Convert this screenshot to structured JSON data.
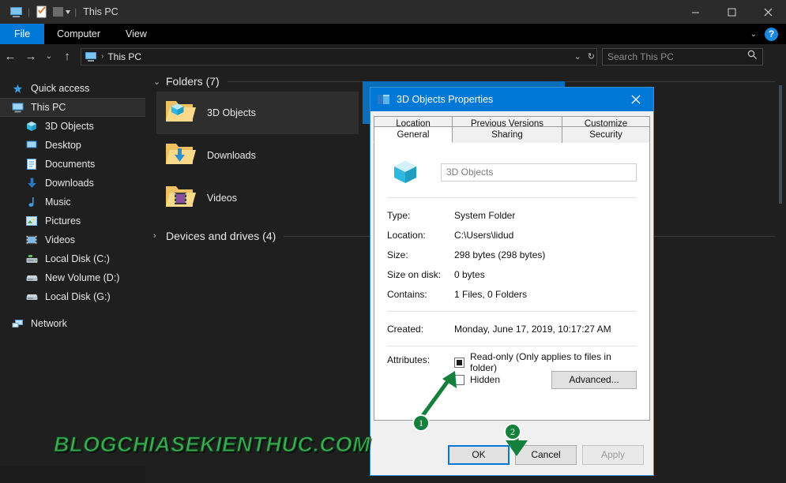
{
  "window": {
    "title": "This PC",
    "quick_access_icons": [
      "this-pc-icon",
      "properties-icon",
      "folder-dropdown-icon"
    ],
    "minimize_label": "Minimize",
    "maximize_label": "Maximize",
    "close_label": "Close"
  },
  "ribbon": {
    "tabs": [
      {
        "label": "File",
        "active": true
      },
      {
        "label": "Computer",
        "active": false
      },
      {
        "label": "View",
        "active": false
      }
    ],
    "expand_label": "⌄",
    "help_label": "?"
  },
  "addressbar": {
    "back_label": "←",
    "forward_label": "→",
    "recent_label": "⌄",
    "up_label": "↑",
    "path_icon": "this-pc-icon",
    "path_separator": "›",
    "path_text": "This PC",
    "dropdown_label": "⌄",
    "refresh_label": "↻",
    "search_placeholder": "Search This PC",
    "search_value": "",
    "search_icon": "search-icon"
  },
  "sidebar": {
    "items": [
      {
        "label": "Quick access",
        "icon": "star-icon",
        "level": 1,
        "selected": false,
        "gap": false
      },
      {
        "label": "This PC",
        "icon": "this-pc-icon",
        "level": 1,
        "selected": true,
        "gap": false
      },
      {
        "label": "3D Objects",
        "icon": "cube-icon",
        "level": 2,
        "selected": false,
        "gap": false
      },
      {
        "label": "Desktop",
        "icon": "desktop-icon",
        "level": 2,
        "selected": false,
        "gap": false
      },
      {
        "label": "Documents",
        "icon": "document-icon",
        "level": 2,
        "selected": false,
        "gap": false
      },
      {
        "label": "Downloads",
        "icon": "download-arrow-icon",
        "level": 2,
        "selected": false,
        "gap": false
      },
      {
        "label": "Music",
        "icon": "music-note-icon",
        "level": 2,
        "selected": false,
        "gap": false
      },
      {
        "label": "Pictures",
        "icon": "picture-icon",
        "level": 2,
        "selected": false,
        "gap": false
      },
      {
        "label": "Videos",
        "icon": "video-icon",
        "level": 2,
        "selected": false,
        "gap": false
      },
      {
        "label": "Local Disk (C:)",
        "icon": "system-drive-icon",
        "level": 2,
        "selected": false,
        "gap": false
      },
      {
        "label": "New Volume (D:)",
        "icon": "drive-icon",
        "level": 2,
        "selected": false,
        "gap": false
      },
      {
        "label": "Local Disk (G:)",
        "icon": "drive-icon",
        "level": 2,
        "selected": false,
        "gap": false
      },
      {
        "label": "Network",
        "icon": "network-icon",
        "level": 1,
        "selected": false,
        "gap": true
      }
    ]
  },
  "content": {
    "groups": [
      {
        "label": "Folders (7)",
        "expanded": true,
        "arrow": "⌄"
      },
      {
        "label": "Devices and drives (4)",
        "expanded": false,
        "arrow": "›"
      }
    ],
    "folders": [
      {
        "name": "3D Objects",
        "icon": "folder-3d-objects-icon",
        "selected": true
      },
      {
        "name": "Downloads",
        "icon": "folder-downloads-icon",
        "selected": false
      },
      {
        "name": "Videos",
        "icon": "folder-videos-icon",
        "selected": false
      }
    ]
  },
  "dialog": {
    "title": "3D Objects Properties",
    "title_icon": "properties-folder-icon",
    "close_label": "✕",
    "tabs_top": [
      {
        "label": "Location",
        "active": false
      },
      {
        "label": "Previous Versions",
        "active": false
      },
      {
        "label": "Customize",
        "active": false
      }
    ],
    "tabs_bottom": [
      {
        "label": "General",
        "active": true
      },
      {
        "label": "Sharing",
        "active": false
      },
      {
        "label": "Security",
        "active": false
      }
    ],
    "folder_icon": "cube-icon",
    "name_value": "3D Objects",
    "properties": [
      {
        "label": "Type:",
        "value": "System Folder"
      },
      {
        "label": "Location:",
        "value": "C:\\Users\\lidud"
      },
      {
        "label": "Size:",
        "value": "298 bytes (298 bytes)"
      },
      {
        "label": "Size on disk:",
        "value": "0 bytes"
      },
      {
        "label": "Contains:",
        "value": "1 Files, 0 Folders"
      }
    ],
    "created": {
      "label": "Created:",
      "value": "Monday, June 17, 2019, 10:17:27 AM"
    },
    "attributes": {
      "label": "Attributes:",
      "readonly_label": "Read-only (Only applies to files in folder)",
      "readonly_state": "indeterminate",
      "hidden_label": "Hidden",
      "hidden_state": "unchecked",
      "advanced_label": "Advanced..."
    },
    "buttons": {
      "ok": "OK",
      "cancel": "Cancel",
      "apply": "Apply",
      "apply_disabled": true
    }
  },
  "annotations": {
    "badge_one": "1",
    "badge_two": "2",
    "accent_color": "#14803c",
    "watermark": "BLOGCHIASEKIENTHUC.COM"
  }
}
